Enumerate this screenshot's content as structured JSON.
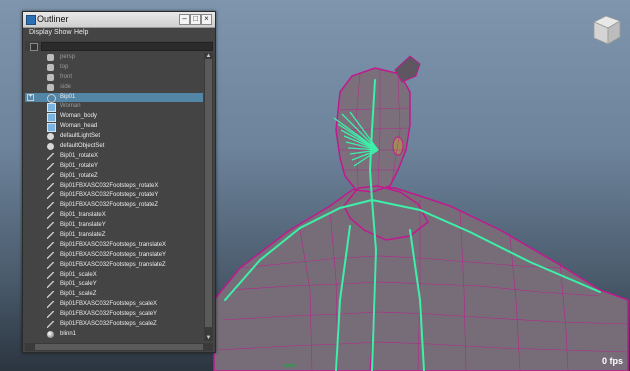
{
  "window": {
    "title": "Outliner",
    "menu": [
      "Display",
      "Show",
      "Help"
    ]
  },
  "outliner_items": [
    {
      "label": "persp",
      "icon": "camera-icon",
      "dim": true
    },
    {
      "label": "top",
      "icon": "camera-icon",
      "dim": true
    },
    {
      "label": "front",
      "icon": "camera-icon",
      "dim": true
    },
    {
      "label": "side",
      "icon": "camera-icon",
      "dim": true
    },
    {
      "label": "Bip01",
      "icon": "joint-icon",
      "selected": true,
      "expandable": true
    },
    {
      "label": "Woman",
      "icon": "mesh-icon",
      "dim": true
    },
    {
      "label": "Woman_body",
      "icon": "mesh-icon"
    },
    {
      "label": "Woman_head",
      "icon": "mesh-icon"
    },
    {
      "label": "defaultLightSet",
      "icon": "set-icon"
    },
    {
      "label": "defaultObjectSet",
      "icon": "set-icon"
    },
    {
      "label": "Bip01_rotateX",
      "icon": "anim-curve-icon"
    },
    {
      "label": "Bip01_rotateY",
      "icon": "anim-curve-icon"
    },
    {
      "label": "Bip01_rotateZ",
      "icon": "anim-curve-icon"
    },
    {
      "label": "Bip01FBXASC032Footsteps_rotateX",
      "icon": "anim-curve-icon"
    },
    {
      "label": "Bip01FBXASC032Footsteps_rotateY",
      "icon": "anim-curve-icon"
    },
    {
      "label": "Bip01FBXASC032Footsteps_rotateZ",
      "icon": "anim-curve-icon"
    },
    {
      "label": "Bip01_translateX",
      "icon": "anim-curve-icon"
    },
    {
      "label": "Bip01_translateY",
      "icon": "anim-curve-icon"
    },
    {
      "label": "Bip01_translateZ",
      "icon": "anim-curve-icon"
    },
    {
      "label": "Bip01FBXASC032Footsteps_translateX",
      "icon": "anim-curve-icon"
    },
    {
      "label": "Bip01FBXASC032Footsteps_translateY",
      "icon": "anim-curve-icon"
    },
    {
      "label": "Bip01FBXASC032Footsteps_translateZ",
      "icon": "anim-curve-icon"
    },
    {
      "label": "Bip01_scaleX",
      "icon": "anim-curve-icon"
    },
    {
      "label": "Bip01_scaleY",
      "icon": "anim-curve-icon"
    },
    {
      "label": "Bip01_scaleZ",
      "icon": "anim-curve-icon"
    },
    {
      "label": "Bip01FBXASC032Footsteps_scaleX",
      "icon": "anim-curve-icon"
    },
    {
      "label": "Bip01FBXASC032Footsteps_scaleY",
      "icon": "anim-curve-icon"
    },
    {
      "label": "Bip01FBXASC032Footsteps_scaleZ",
      "icon": "anim-curve-icon"
    },
    {
      "label": "blinn1",
      "icon": "shader-icon"
    }
  ],
  "viewport": {
    "fps": "0 fps",
    "colors": {
      "wireframe": "#c0198f",
      "skeleton": "#3cf0a8",
      "mesh": "#7a6e78",
      "selection": "#5285a6"
    }
  }
}
